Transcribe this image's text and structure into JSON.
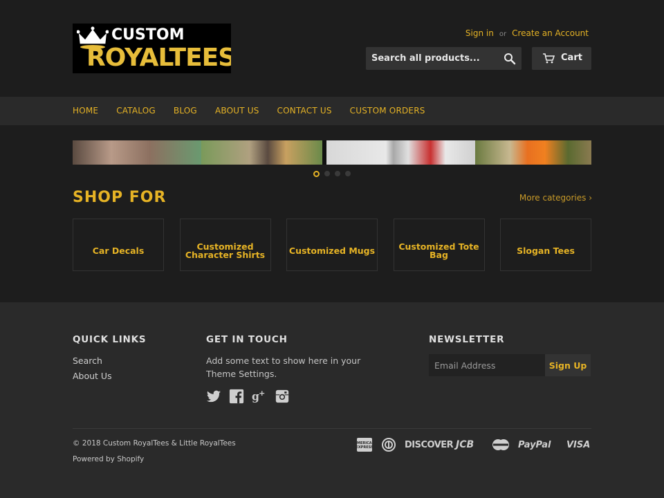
{
  "logo": {
    "line1": "CUSTOM",
    "line2": "ROYALTEES"
  },
  "account": {
    "sign_in": "Sign in",
    "or": "or",
    "create": "Create an Account"
  },
  "search": {
    "placeholder": "Search all products..."
  },
  "cart": {
    "label": "Cart"
  },
  "nav": [
    "HOME",
    "CATALOG",
    "BLOG",
    "ABOUT US",
    "CONTACT US",
    "CUSTOM ORDERS"
  ],
  "shop": {
    "title": "SHOP FOR",
    "more": "More categories ›"
  },
  "categories": [
    {
      "label": "Car Decals"
    },
    {
      "label": "Customized Character Shirts"
    },
    {
      "label": "Customized Mugs"
    },
    {
      "label": "Customized Tote Bag"
    },
    {
      "label": "Slogan Tees"
    }
  ],
  "footer": {
    "quick_links": {
      "title": "QUICK LINKS",
      "items": [
        "Search",
        "About Us"
      ]
    },
    "get_in_touch": {
      "title": "GET IN TOUCH",
      "text": "Add some text to show here in your Theme Settings."
    },
    "newsletter": {
      "title": "NEWSLETTER",
      "placeholder": "Email Address",
      "button": "Sign Up"
    },
    "copyright": "© 2018 Custom RoyalTees & Little RoyalTees",
    "powered": "Powered by Shopify",
    "payments": {
      "discover": "DISCOVER",
      "jcb": "JCB",
      "paypal": "PayPal",
      "visa": "VISA"
    }
  },
  "slider": {
    "active_index": 0,
    "count": 4
  },
  "colors": {
    "accent": "#e6b325",
    "background": "#1d1d1d",
    "footer_bg": "#2a2a2a"
  }
}
